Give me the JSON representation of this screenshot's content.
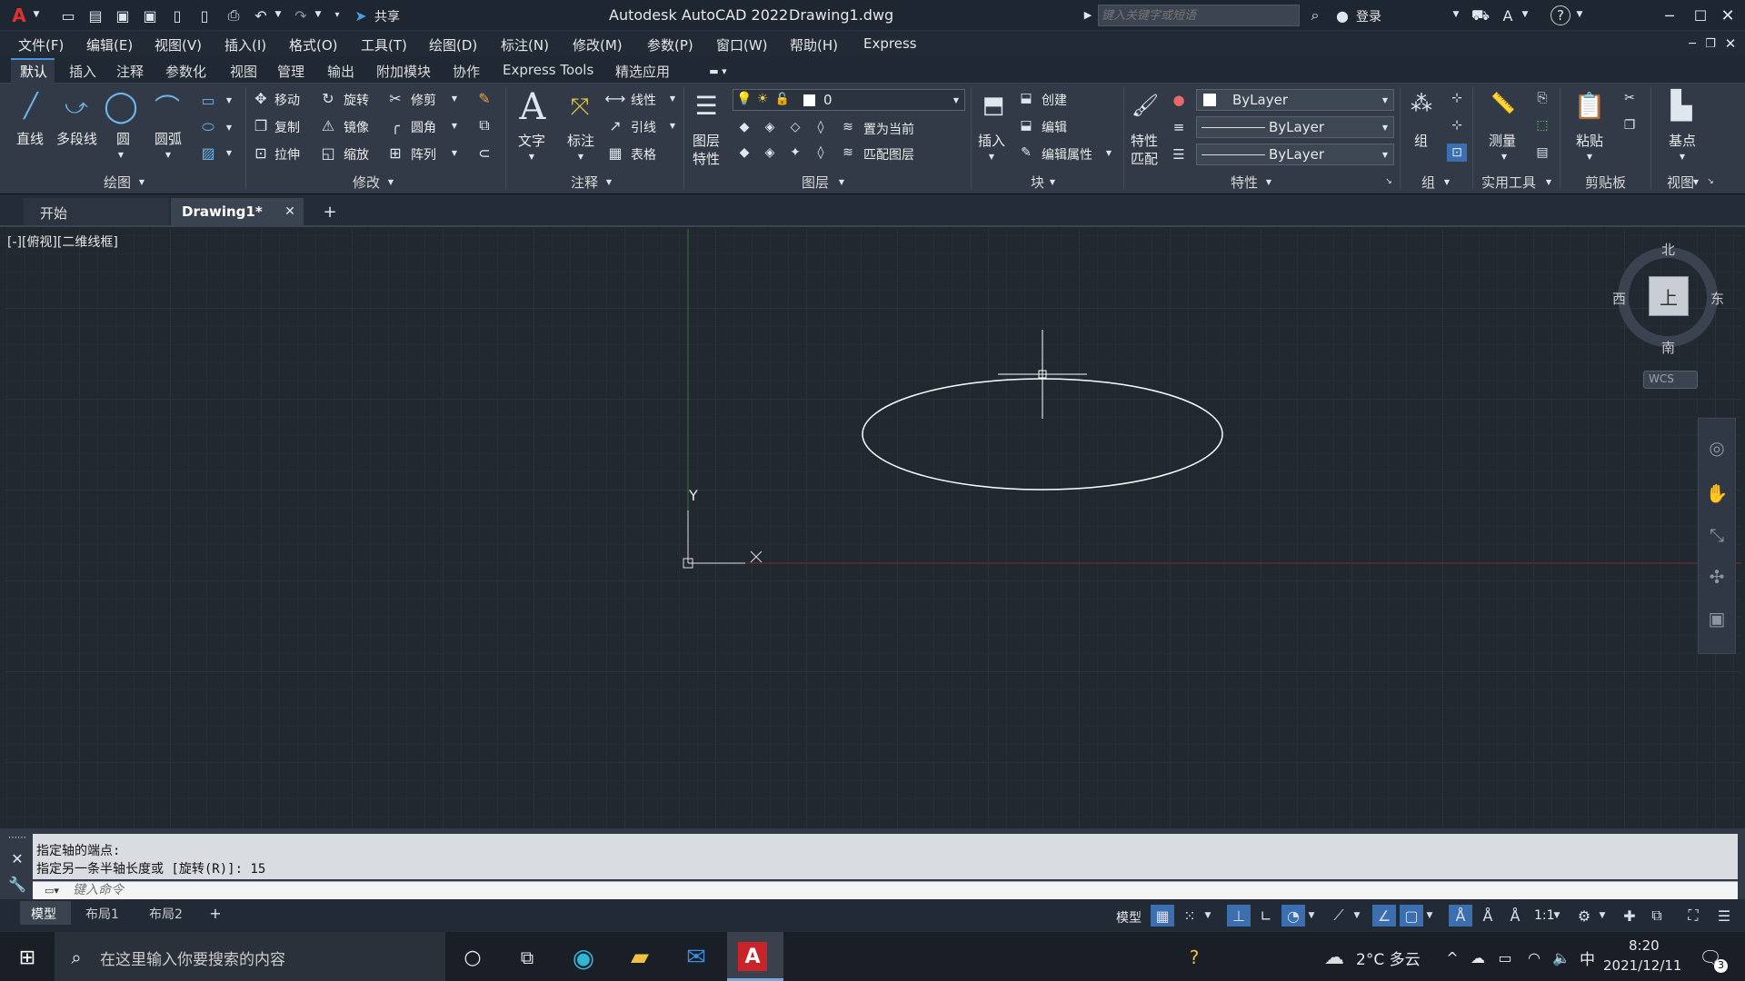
{
  "title_bar": {
    "app_title": "Autodesk AutoCAD 2022",
    "file_name": "Drawing1.dwg",
    "share_label": "共享",
    "search_placeholder": "键入关键字或短语",
    "login_label": "登录"
  },
  "menu": [
    "文件(F)",
    "编辑(E)",
    "视图(V)",
    "插入(I)",
    "格式(O)",
    "工具(T)",
    "绘图(D)",
    "标注(N)",
    "修改(M)",
    "参数(P)",
    "窗口(W)",
    "帮助(H)",
    "Express"
  ],
  "ribbon_tabs": [
    "默认",
    "插入",
    "注释",
    "参数化",
    "视图",
    "管理",
    "输出",
    "附加模块",
    "协作",
    "Express Tools",
    "精选应用"
  ],
  "ribbon": {
    "draw": {
      "line": "直线",
      "polyline": "多段线",
      "circle": "圆",
      "arc": "圆弧",
      "panel": "绘图"
    },
    "modify": {
      "move": "移动",
      "rotate": "旋转",
      "trim": "修剪",
      "copy": "复制",
      "mirror": "镜像",
      "fillet": "圆角",
      "stretch": "拉伸",
      "scale": "缩放",
      "array": "阵列",
      "panel": "修改"
    },
    "annotation": {
      "text": "文字",
      "dimension": "标注",
      "linear": "线性",
      "leader": "引线",
      "table": "表格",
      "panel": "注释"
    },
    "layers": {
      "props_line1": "图层",
      "props_line2": "特性",
      "layer_value": "0",
      "set_current": "置为当前",
      "match_layer": "匹配图层",
      "panel": "图层"
    },
    "block": {
      "insert": "插入",
      "create": "创建",
      "edit": "编辑",
      "edit_attr": "编辑属性",
      "panel": "块"
    },
    "properties": {
      "match_line1": "特性",
      "match_line2": "匹配",
      "color": "ByLayer",
      "lineweight": "ByLayer",
      "linetype": "ByLayer",
      "panel": "特性"
    },
    "groups": {
      "group": "组",
      "panel": "组"
    },
    "utilities": {
      "measure": "测量",
      "panel": "实用工具"
    },
    "clipboard": {
      "paste": "粘贴",
      "panel": "剪贴板"
    },
    "view": {
      "base": "基点",
      "panel": "视图"
    }
  },
  "doc_tabs": {
    "start": "开始",
    "drawing": "Drawing1*"
  },
  "viewport": {
    "label": "[-][俯视][二维线框]",
    "ucs_y": "Y",
    "ucs_x": "X",
    "viewcube": {
      "north": "北",
      "south": "南",
      "east": "东",
      "west": "西",
      "top": "上",
      "wcs": "WCS"
    }
  },
  "command": {
    "history": [
      "指定轴的端点:",
      "指定另一条半轴长度或 [旋转(R)]: 15"
    ],
    "placeholder": "键入命令"
  },
  "layout_tabs": [
    "模型",
    "布局1",
    "布局2"
  ],
  "status_bar": {
    "model": "模型",
    "scale": "1:1"
  },
  "taskbar": {
    "search_placeholder": "在这里输入你要搜索的内容",
    "weather": "2°C 多云",
    "ime": "中",
    "time": "8:20",
    "date": "2021/12/11",
    "notification_count": "3"
  },
  "colors": {
    "accent": "#3b6fb0",
    "background": "#212830",
    "axis_y": "#2f7a2f",
    "axis_x": "#7a2a2a"
  }
}
